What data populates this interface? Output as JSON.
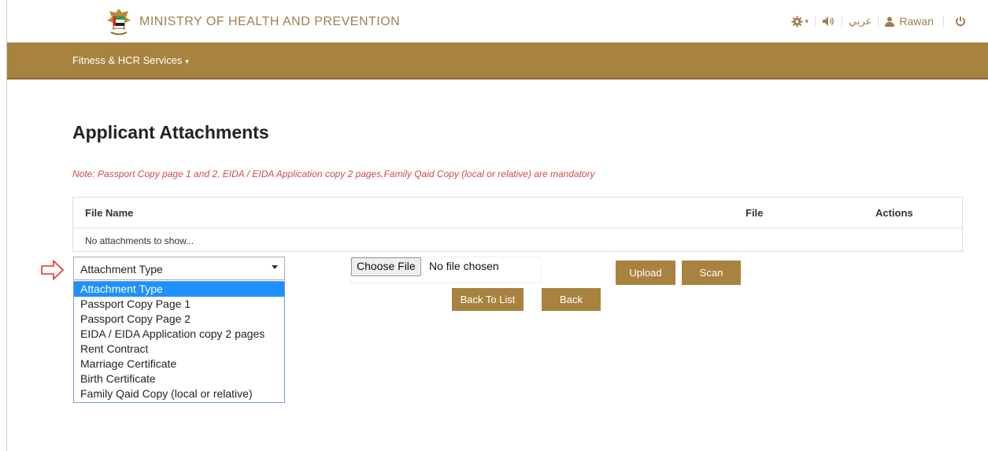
{
  "header": {
    "ministry_name": "MINISTRY OF HEALTH AND PREVENTION",
    "language_label": "عربي",
    "user_name": "Rawan",
    "brand_color": "#a8833f"
  },
  "nav": {
    "menu_label": "Fitness & HCR Services"
  },
  "page": {
    "title": "Applicant Attachments",
    "note": "Note: Passport Copy page 1 and 2, EIDA / EIDA Application copy 2 pages,Family Qaid Copy (local or relative) are mandatory"
  },
  "table": {
    "columns": [
      "File Name",
      "File",
      "Actions"
    ],
    "empty_message": "No attachments to show..."
  },
  "attachment_select": {
    "selected": "Attachment Type",
    "options": [
      "Attachment Type",
      "Passport Copy Page 1",
      "Passport Copy Page 2",
      "EIDA / EIDA Application copy 2 pages",
      "Rent Contract",
      "Marriage Certificate",
      "Birth Certificate",
      "Family Qaid Copy (local or relative)"
    ]
  },
  "file_input": {
    "button_label": "Choose File",
    "status": "No file chosen"
  },
  "buttons": {
    "upload": "Upload",
    "scan": "Scan",
    "back_to_list": "Back To List",
    "back": "Back"
  }
}
